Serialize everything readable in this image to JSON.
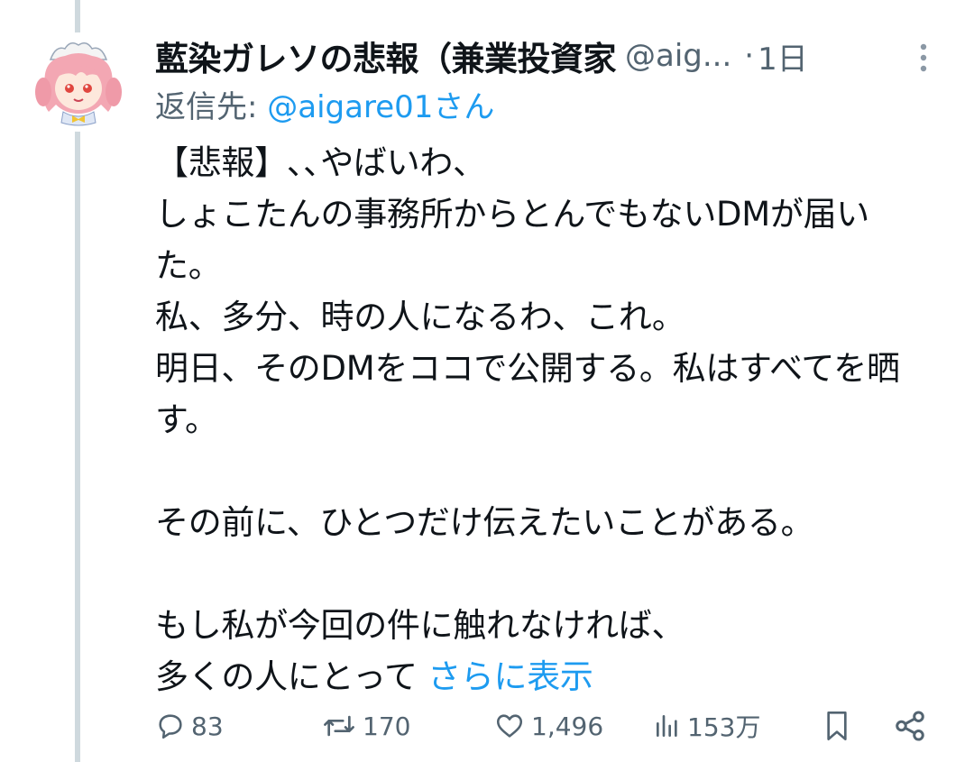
{
  "tweet": {
    "display_name": "藍染ガレソの悲報（兼業投資家",
    "handle": "@aig...",
    "separator": "·",
    "time": "1日",
    "replying_to_label": "返信先: ",
    "replying_to_handle": "@aigare01さん",
    "body": "【悲報】､､やばいわ、\nしょこたんの事務所からとんでもないDMが届いた。\n私、多分、時の人になるわ、これ。\n明日、そのDMをココで公開する。私はすべてを晒す。\n\nその前に、ひとつだけ伝えたいことがある。\n\nもし私が今回の件に触れなければ、\n多くの人にとって ",
    "show_more": "さらに表示"
  },
  "actions": {
    "replies": "83",
    "retweets": "170",
    "likes": "1,496",
    "views": "153万"
  },
  "icons": {
    "reply": "reply-icon",
    "retweet": "retweet-icon",
    "like": "heart-icon",
    "views": "views-icon",
    "bookmark": "bookmark-icon",
    "share": "share-icon",
    "more": "more-icon"
  },
  "colors": {
    "link": "#1d9bf0",
    "secondary": "#536471",
    "text": "#0f1419",
    "thread_line": "#cfd9de"
  }
}
